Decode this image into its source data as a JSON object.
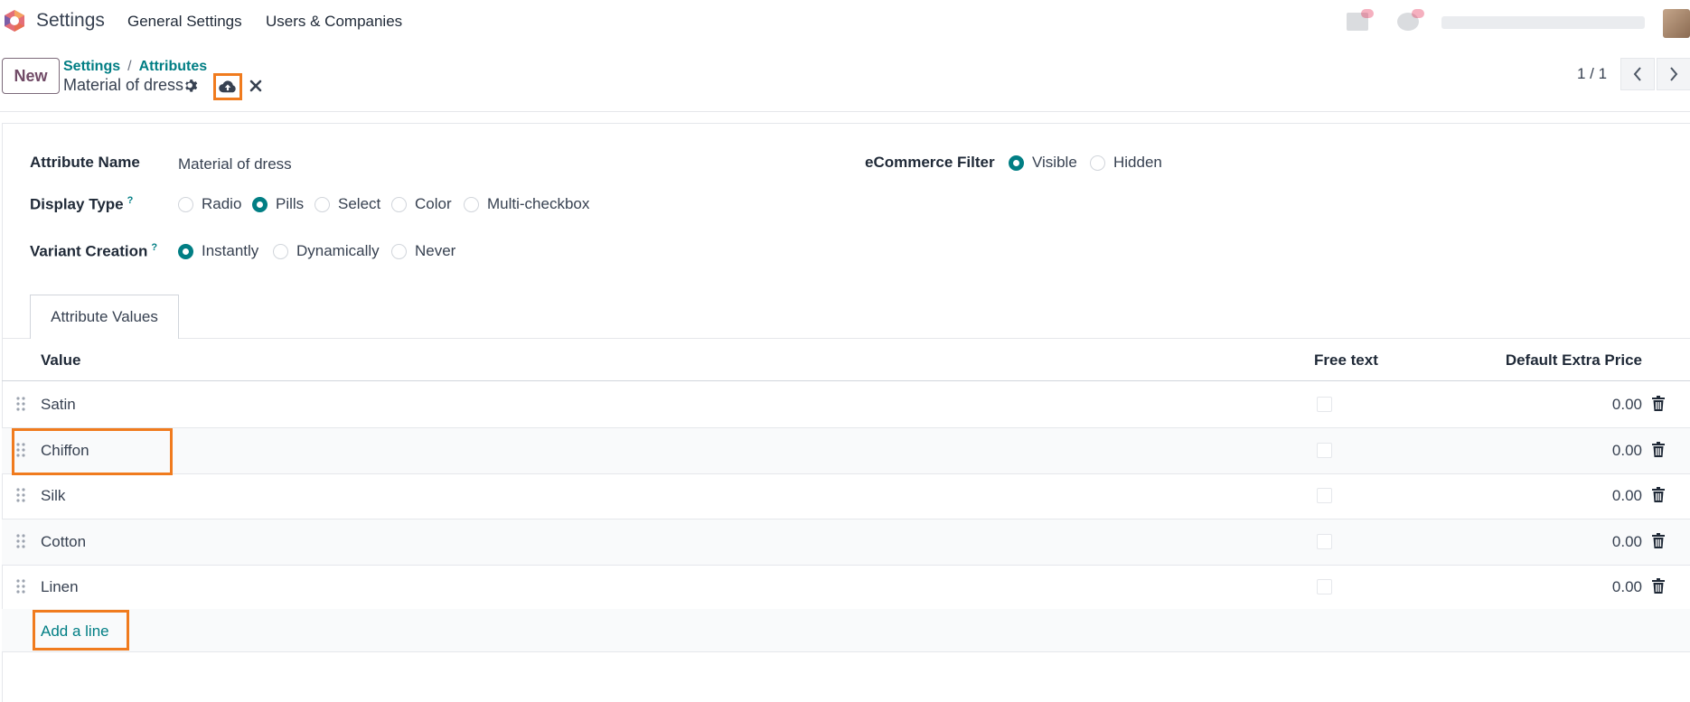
{
  "navbar": {
    "app_title": "Settings",
    "menus": [
      "General Settings",
      "Users & Companies"
    ]
  },
  "control_panel": {
    "new_label": "New",
    "breadcrumb": [
      "Settings",
      "Attributes"
    ],
    "breadcrumb_separator": "/",
    "record_name": "Material of dress",
    "pager_value": "1 / 1"
  },
  "form": {
    "attribute_name_label": "Attribute Name",
    "attribute_name_value": "Material of dress",
    "display_type_label": "Display Type",
    "display_type_help": "?",
    "display_type_options": [
      "Radio",
      "Pills",
      "Select",
      "Color",
      "Multi-checkbox"
    ],
    "display_type_selected": "Pills",
    "variant_creation_label": "Variant Creation",
    "variant_creation_help": "?",
    "variant_creation_options": [
      "Instantly",
      "Dynamically",
      "Never"
    ],
    "variant_creation_selected": "Instantly",
    "ecommerce_filter_label": "eCommerce Filter",
    "ecommerce_filter_options": [
      "Visible",
      "Hidden"
    ],
    "ecommerce_filter_selected": "Visible"
  },
  "tabs": {
    "attribute_values": "Attribute Values"
  },
  "table": {
    "headers": {
      "value": "Value",
      "free_text": "Free text",
      "default_extra_price": "Default Extra Price"
    },
    "rows": [
      {
        "name": "Satin",
        "free_text": false,
        "price": "0.00"
      },
      {
        "name": "Chiffon",
        "free_text": false,
        "price": "0.00"
      },
      {
        "name": "Silk",
        "free_text": false,
        "price": "0.00"
      },
      {
        "name": "Cotton",
        "free_text": false,
        "price": "0.00"
      },
      {
        "name": "Linen",
        "free_text": false,
        "price": "0.00"
      }
    ],
    "add_line": "Add a line"
  },
  "colors": {
    "accent": "#017e84",
    "brand": "#714b67",
    "highlight": "#f07b1e"
  },
  "icons": [
    "odoo-logo-icon",
    "gear-icon",
    "cloud-upload-icon",
    "close-icon",
    "chevron-left-icon",
    "chevron-right-icon",
    "drag-handle-icon",
    "trash-icon"
  ]
}
